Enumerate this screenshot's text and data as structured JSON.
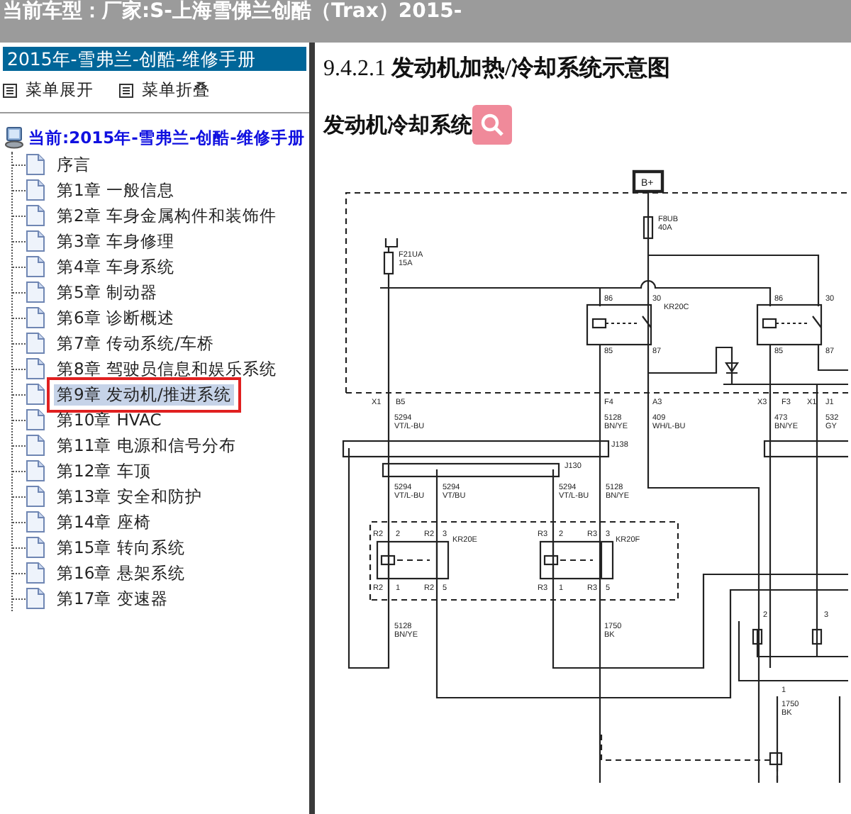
{
  "title_bar": {
    "title": "当前车型：厂家:S-上海雪佛兰创酷（Trax）2015-"
  },
  "sidebar": {
    "header": "2015年-雪弗兰-创酷-维修手册",
    "actions": [
      "菜单展开",
      "菜单折叠"
    ],
    "tree": {
      "label": "当前:2015年-雪弗兰-创酷-维修手册",
      "children": [
        {
          "label": "序言",
          "selected": false
        },
        {
          "label": "第1章 一般信息",
          "selected": false
        },
        {
          "label": "第2章 车身金属构件和装饰件",
          "selected": false
        },
        {
          "label": "第3章 车身修理",
          "selected": false
        },
        {
          "label": "第4章 车身系统",
          "selected": false
        },
        {
          "label": "第5章 制动器",
          "selected": false
        },
        {
          "label": "第6章 诊断概述",
          "selected": false
        },
        {
          "label": "第7章 传动系统/车桥",
          "selected": false
        },
        {
          "label": "第8章 驾驶员信息和娱乐系统",
          "selected": false
        },
        {
          "label": "第9章 发动机/推进系统",
          "selected": true
        },
        {
          "label": "第10章 HVAC",
          "selected": false
        },
        {
          "label": "第11章 电源和信号分布",
          "selected": false
        },
        {
          "label": "第12章 车顶",
          "selected": false
        },
        {
          "label": "第13章 安全和防护",
          "selected": false
        },
        {
          "label": "第14章 座椅",
          "selected": false
        },
        {
          "label": "第15章 转向系统",
          "selected": false
        },
        {
          "label": "第16章 悬架系统",
          "selected": false
        },
        {
          "label": "第17章 变速器",
          "selected": false
        }
      ]
    }
  },
  "content": {
    "section_title": "9.4.2.1 **发动机加热/冷却系统示意图**",
    "heading": "发动机冷却系统",
    "diagram": {
      "labels": [
        "B+",
        "F21UA",
        "15A",
        "F8UB",
        "40A",
        "86",
        "30",
        "85",
        "87",
        "86",
        "30",
        "85",
        "87",
        "X1",
        "B5",
        "F4",
        "A3",
        "X3",
        "F3",
        "X1",
        "J1",
        "5294",
        "VT/L-BU",
        "5128",
        "BN/YE",
        "409",
        "WH/L-BU",
        "473",
        "BN/YE",
        "532",
        "GY",
        "J138",
        "J130",
        "5294",
        "VT/L-BU",
        "5294",
        "VT/BU",
        "5294",
        "VT/L-BU",
        "5128",
        "BN/YE",
        "R2",
        "2",
        "R2",
        "3",
        "R3",
        "2",
        "R3",
        "3",
        "R2",
        "1",
        "R2",
        "5",
        "R3",
        "1",
        "R3",
        "5",
        "5128",
        "BN/YE",
        "1750",
        "BK",
        "2",
        "3",
        "1",
        "1750",
        "BK",
        "KR20C",
        "KR20E",
        "KR20F"
      ]
    }
  }
}
